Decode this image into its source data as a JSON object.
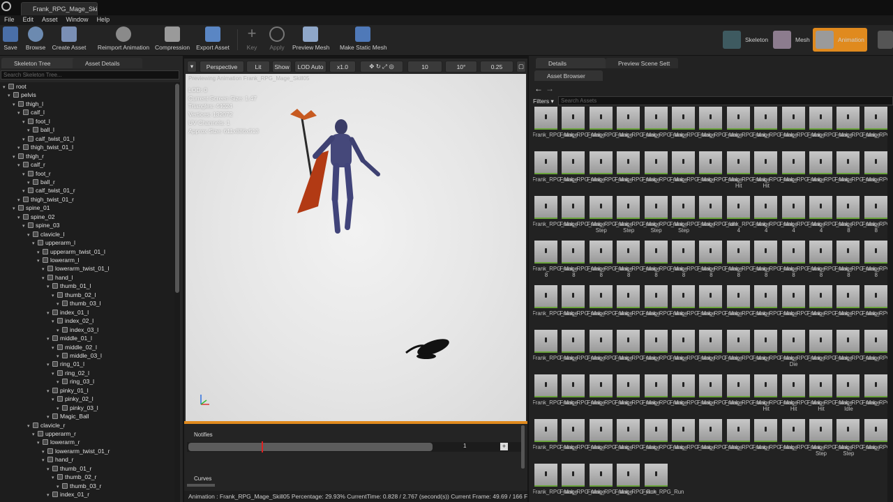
{
  "window": {
    "tab_title": "Frank_RPG_Mage_Skill05"
  },
  "menu": [
    "File",
    "Edit",
    "Asset",
    "Window",
    "Help"
  ],
  "toolbar": {
    "buttons": [
      {
        "label": "Save",
        "enabled": true,
        "icon": "save-icon"
      },
      {
        "label": "Browse",
        "enabled": true,
        "icon": "browse-icon"
      },
      {
        "label": "Create Asset",
        "enabled": true,
        "icon": "create-asset-icon"
      },
      {
        "label": "Reimport Animation",
        "enabled": true,
        "icon": "reimport-icon"
      },
      {
        "label": "Compression",
        "enabled": true,
        "icon": "compression-icon"
      },
      {
        "label": "Export Asset",
        "enabled": true,
        "icon": "export-icon"
      },
      {
        "label": "Key",
        "enabled": false,
        "icon": "plus-icon"
      },
      {
        "label": "Apply",
        "enabled": false,
        "icon": "apply-icon"
      },
      {
        "label": "Preview Mesh",
        "enabled": true,
        "icon": "preview-mesh-icon"
      },
      {
        "label": "Make Static Mesh",
        "enabled": true,
        "icon": "static-mesh-icon"
      }
    ],
    "modes": [
      {
        "label": "Skeleton"
      },
      {
        "label": "Mesh"
      },
      {
        "label": "Animation",
        "active": true
      }
    ],
    "accent": "#e08a1e"
  },
  "left_panel": {
    "tabs": [
      "Skeleton Tree",
      "Asset Details"
    ],
    "search_placeholder": "Search Skeleton Tree...",
    "bones": [
      {
        "name": "root",
        "depth": 0
      },
      {
        "name": "pelvis",
        "depth": 1
      },
      {
        "name": "thigh_l",
        "depth": 2
      },
      {
        "name": "calf_l",
        "depth": 3
      },
      {
        "name": "foot_l",
        "depth": 4
      },
      {
        "name": "ball_l",
        "depth": 5
      },
      {
        "name": "calf_twist_01_l",
        "depth": 4
      },
      {
        "name": "thigh_twist_01_l",
        "depth": 3
      },
      {
        "name": "thigh_r",
        "depth": 2
      },
      {
        "name": "calf_r",
        "depth": 3
      },
      {
        "name": "foot_r",
        "depth": 4
      },
      {
        "name": "ball_r",
        "depth": 5
      },
      {
        "name": "calf_twist_01_r",
        "depth": 4
      },
      {
        "name": "thigh_twist_01_r",
        "depth": 3
      },
      {
        "name": "spine_01",
        "depth": 2
      },
      {
        "name": "spine_02",
        "depth": 3
      },
      {
        "name": "spine_03",
        "depth": 4
      },
      {
        "name": "clavicle_l",
        "depth": 5
      },
      {
        "name": "upperarm_l",
        "depth": 6
      },
      {
        "name": "upperarm_twist_01_l",
        "depth": 7
      },
      {
        "name": "lowerarm_l",
        "depth": 7
      },
      {
        "name": "lowerarm_twist_01_l",
        "depth": 8
      },
      {
        "name": "hand_l",
        "depth": 8
      },
      {
        "name": "thumb_01_l",
        "depth": 9
      },
      {
        "name": "thumb_02_l",
        "depth": 10
      },
      {
        "name": "thumb_03_l",
        "depth": 11
      },
      {
        "name": "index_01_l",
        "depth": 9
      },
      {
        "name": "index_02_l",
        "depth": 10
      },
      {
        "name": "index_03_l",
        "depth": 11
      },
      {
        "name": "middle_01_l",
        "depth": 9
      },
      {
        "name": "middle_02_l",
        "depth": 10
      },
      {
        "name": "middle_03_l",
        "depth": 11
      },
      {
        "name": "ring_01_l",
        "depth": 9
      },
      {
        "name": "ring_02_l",
        "depth": 10
      },
      {
        "name": "ring_03_l",
        "depth": 11
      },
      {
        "name": "pinky_01_l",
        "depth": 9
      },
      {
        "name": "pinky_02_l",
        "depth": 10
      },
      {
        "name": "pinky_03_l",
        "depth": 11
      },
      {
        "name": "Magic_Ball",
        "depth": 9
      },
      {
        "name": "clavicle_r",
        "depth": 5
      },
      {
        "name": "upperarm_r",
        "depth": 6
      },
      {
        "name": "lowerarm_r",
        "depth": 7
      },
      {
        "name": "lowerarm_twist_01_r",
        "depth": 8
      },
      {
        "name": "hand_r",
        "depth": 8
      },
      {
        "name": "thumb_01_r",
        "depth": 9
      },
      {
        "name": "thumb_02_r",
        "depth": 10
      },
      {
        "name": "thumb_03_r",
        "depth": 11
      },
      {
        "name": "index_01_r",
        "depth": 9
      }
    ]
  },
  "viewport": {
    "toolbar": {
      "perspective": "Perspective",
      "lit": "Lit",
      "show": "Show",
      "lod": "LOD Auto",
      "speed": "x1.0",
      "grid": "10",
      "angle": "10°",
      "scale": "0.25"
    },
    "previewing": "Previewing Animation Frank_RPG_Mage_Skill05",
    "info": [
      "LOD: 0",
      "Current Screen Size: 1.47",
      "Triangles: 44024",
      "Vertices: 132072",
      "UV Channels: 1",
      "Approx Size: 611x886x513"
    ]
  },
  "timeline": {
    "notifies_label": "Notifies",
    "curves_label": "Curves",
    "track_value": "1",
    "playhead_fraction": 0.299
  },
  "status": {
    "text": "Animation : Frank_RPG_Mage_Skill05  Percentage: 29.93% CurrentTime: 0.828 / 2.767 (second(s)) Current Frame: 49.69 / 166 Frames"
  },
  "right_panel": {
    "tabs_top": [
      "Details",
      "Preview Scene Sett"
    ],
    "tab_bottom": "Asset Browser",
    "filters_label": "Filters",
    "search_placeholder": "Search Assets",
    "assets": [
      [
        "Frank_RPG_Mage",
        "Frank_RPG_Mage",
        "Frank_RPG_Mage",
        "Frank_RPG_Mage",
        "Frank_RPG_Mage",
        "Frank_RPG_Mage",
        "Frank_RPG_Mage",
        "Frank_RPG_Mage",
        "Frank_RPG_Mage",
        "Frank_RPG_Mage",
        "Frank_RPG_Mage",
        "Frank_RPG_Mage",
        "Frank_RPG_Mage"
      ],
      [
        "Frank_RPG_Mage",
        "Frank_RPG_Mage",
        "Frank_RPG_Mage",
        "Frank_RPG_Mage",
        "Frank_RPG_Mage",
        "Frank_RPG_Mage",
        "Frank_RPG_Mage",
        "Frank_RPG_Mage Hit",
        "Frank_RPG_Mage Hit",
        "Frank_RPG_Mage",
        "Frank_RPG_Mage",
        "Frank_RPG_Mage",
        "Frank_RPG_Mage"
      ],
      [
        "Frank_RPG_Mage",
        "Frank_RPG_Mage",
        "Frank_RPG_Mage Step",
        "Frank_RPG_Mage Step",
        "Frank_RPG_Mage Step",
        "Frank_RPG_Mage Step",
        "Frank_RPG_Idle",
        "Frank_RPG_Mage 4",
        "Frank_RPG_Mage 4",
        "Frank_RPG_Mage 4",
        "Frank_RPG_Mage 4",
        "Frank_RPG_Mage 8",
        "Frank_RPG_Mage 8"
      ],
      [
        "Frank_RPG_Mage 8",
        "Frank_RPG_Mage 8",
        "Frank_RPG_Mage 8",
        "Frank_RPG_Mage 8",
        "Frank_RPG_Mage 8",
        "Frank_RPG_Mage 8",
        "Frank_RPG_Mage 8",
        "Frank_RPG_Mage 8",
        "Frank_RPG_Mage 8",
        "Frank_RPG_Mage 8",
        "Frank_RPG_Mage 8",
        "Frank_RPG_Mage 8",
        "Frank_RPG_Mage 8"
      ],
      [
        "Frank_RPG_Mage",
        "Frank_RPG_Mage",
        "Frank_RPG_Mage",
        "Frank_RPG_Mage",
        "Frank_RPG_Mage",
        "Frank_RPG_Mage",
        "Frank_RPG_Mage",
        "Frank_RPG_Mage",
        "Frank_RPG_Mage",
        "Frank_RPG_Mage",
        "Frank_RPG_Mage",
        "Frank_RPG_Mage",
        "Frank_RPG_Mage"
      ],
      [
        "Frank_RPG_Mage",
        "Frank_RPG_Mage",
        "Frank_RPG_Mage",
        "Frank_RPG_Mage",
        "Frank_RPG_Mage",
        "Frank_RPG_Mage",
        "Frank_RPG_Mage",
        "Frank_RPG_Mage",
        "Frank_RPG_Mage",
        "Frank_RPG_Mage Die",
        "Frank_RPG_Mage",
        "Frank_RPG_Mage",
        "Frank_RPG_Mage"
      ],
      [
        "Frank_RPG_Mage",
        "Frank_RPG_Mage",
        "Frank_RPG_Mage",
        "Frank_RPG_Mage",
        "Frank_RPG_Mage",
        "Frank_RPG_Mage",
        "Frank_RPG_Mage",
        "Frank_RPG_Mage",
        "Frank_RPG_Mage Hit",
        "Frank_RPG_Mage Hit",
        "Frank_RPG_Mage Hit",
        "Frank_RPG_Mage Idle",
        "Frank_RPG_Mage"
      ],
      [
        "Frank_RPG_Mage",
        "Frank_RPG_Mage",
        "Frank_RPG_Mage",
        "Frank_RPG_Mage",
        "Frank_RPG_Mage",
        "Frank_RPG_Mage",
        "Frank_RPG_Mage",
        "Frank_RPG_Mage",
        "Frank_RPG_Mage",
        "Frank_RPG_Mage",
        "Frank_RPG_Mage Step",
        "Frank_RPG_Mage Step",
        "Frank_RPG_Mage"
      ],
      [
        "Frank_RPG_Mage",
        "Frank_RPG_Mage",
        "Frank_RPG_Mage",
        "Frank_RPG_Run",
        "Frank_RPG_Run"
      ]
    ]
  }
}
